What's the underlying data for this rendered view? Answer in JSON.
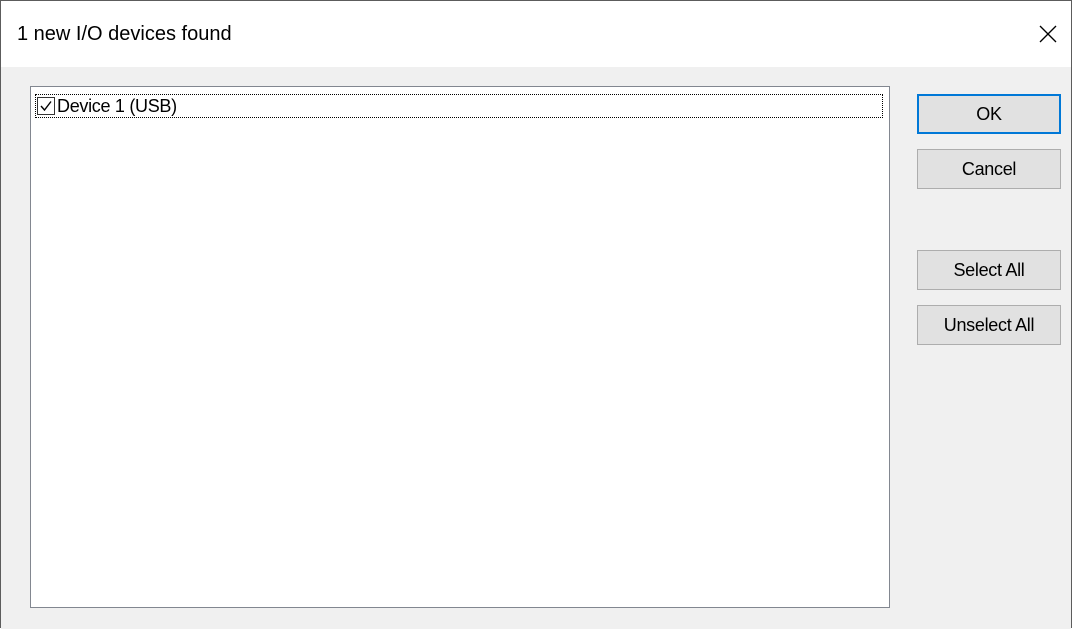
{
  "window": {
    "title": "1 new I/O devices found",
    "close_icon": "close-icon"
  },
  "device_list": {
    "items": [
      {
        "label": "Device 1 (USB)",
        "checked": true
      }
    ]
  },
  "buttons": {
    "ok": "OK",
    "cancel": "Cancel",
    "select_all": "Select All",
    "unselect_all": "Unselect All"
  },
  "colors": {
    "default_button_border": "#0078d7",
    "button_face": "#e1e1e1",
    "dialog_background": "#f0f0f0"
  }
}
